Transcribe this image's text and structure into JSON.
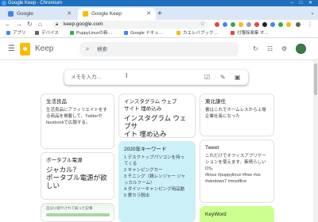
{
  "window": {
    "title": "Google Keep - Chromium",
    "controls": "– □ ✕"
  },
  "tabs": [
    {
      "label": "Google",
      "active": false
    },
    {
      "label": "Google Keep",
      "active": true
    }
  ],
  "toolbar": {
    "url": "keep.google.com",
    "back_icon": "←",
    "forward_icon": "→",
    "reload_icon": "↻",
    "home_icon": "⌂"
  },
  "bookmarks": [
    {
      "label": "アプリ",
      "color": "#4285f4"
    },
    {
      "label": "デバイス",
      "color": "#5f6368"
    },
    {
      "label": "PuppyLinuxの新…",
      "color": "#34a853"
    },
    {
      "label": "Google ドキュ…",
      "color": "#4285f4"
    },
    {
      "label": "カエレバブック…",
      "color": "#fbbc04"
    },
    {
      "label": "付箋除楽集 オ…",
      "color": "#ea4335"
    }
  ],
  "keep": {
    "title": "Keep",
    "search_placeholder": "検索",
    "composer_placeholder": "メモを入力…",
    "cursor": "I"
  },
  "notes": [
    {
      "title": "生活良品",
      "body": "生活良品にアフィリエイトをす\nる商品を掲載して、Twitterや\nfacebookで広報する。",
      "big": ""
    },
    {
      "title": "インスタグラム ウェブ\nサイト 埋め込み",
      "body": "",
      "big": "インスタグラム ウェブサ\nイト 埋め込み"
    },
    {
      "title": "東北謙任",
      "body": "書はこれでホームレスから上場\n企業社長になった",
      "big": ""
    },
    {
      "title": "ポータブル電源",
      "body": "",
      "big": "ジャカル？\nポータブル電源が欲しい"
    },
    {
      "title": "2020年キーワード",
      "body": "1 デスクトップパソコンを持っ\nてくる\n2 キャンピングカー\n3 チニング（鶏レンジャー ジャ\nッカルフーム）\n4 ダイソーキャンピング用品動\n5 寮カラ脱出",
      "big": ""
    },
    {
      "title": "Tweet",
      "body": "これだけでオフィスアプリケー\nションを使えます。素晴らしい\nOS。\n#linux #puppylinux #free #os\n#windows7 #msoffice",
      "big": ""
    },
    {
      "title": "KeyWord",
      "body": "",
      "big": ""
    },
    {
      "caption": "自分に紹介されて知った記事"
    }
  ],
  "colors": {
    "titlebar": "#1f6fbf",
    "note_teal": "#cbf0f8",
    "note_green": "#ccff90",
    "keep_yellow": "#fbbc04"
  }
}
